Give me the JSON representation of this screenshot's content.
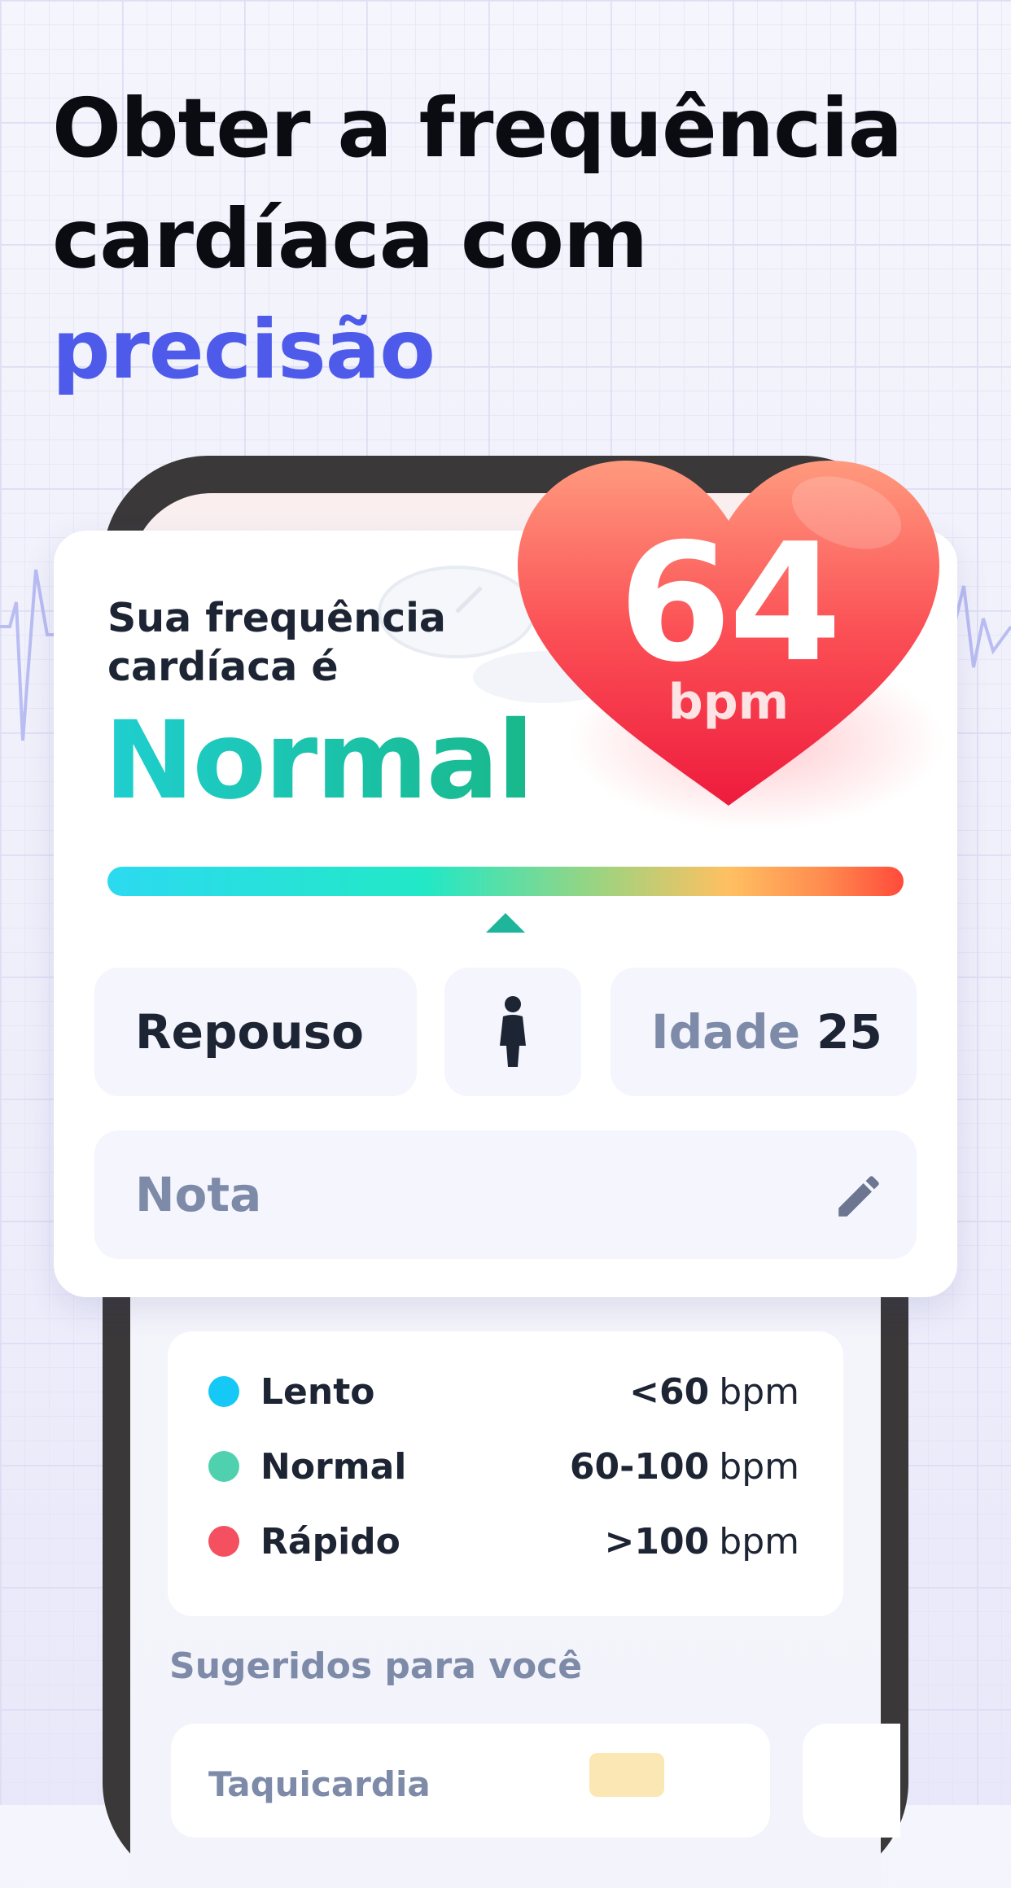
{
  "headline": {
    "line1": "Obter a frequência",
    "line2": "cardíaca com",
    "accent": "precisão"
  },
  "result": {
    "intro": "Sua frequência cardíaca é",
    "status": "Normal",
    "bpm_value": "64",
    "bpm_unit": "bpm",
    "scale_marker_position_fraction": 0.5
  },
  "chips": {
    "activity": "Repouso",
    "gender_icon": "person-icon",
    "age_label": "Idade",
    "age_value": "25"
  },
  "note": {
    "placeholder": "Nota",
    "icon": "pencil-icon"
  },
  "ranges": [
    {
      "name": "Lento",
      "value": "<60",
      "unit": "bpm",
      "color": "#16c8f5"
    },
    {
      "name": "Normal",
      "value": "60-100",
      "unit": "bpm",
      "color": "#4fd1b0"
    },
    {
      "name": "Rápido",
      "value": ">100",
      "unit": "bpm",
      "color": "#f4505f"
    }
  ],
  "suggested": {
    "title": "Sugeridos para você",
    "cards": [
      {
        "title": "Taquicardia"
      }
    ]
  },
  "colors": {
    "accent": "#4e5bea",
    "normal": "#18b88a",
    "heart": "#f4404f"
  }
}
